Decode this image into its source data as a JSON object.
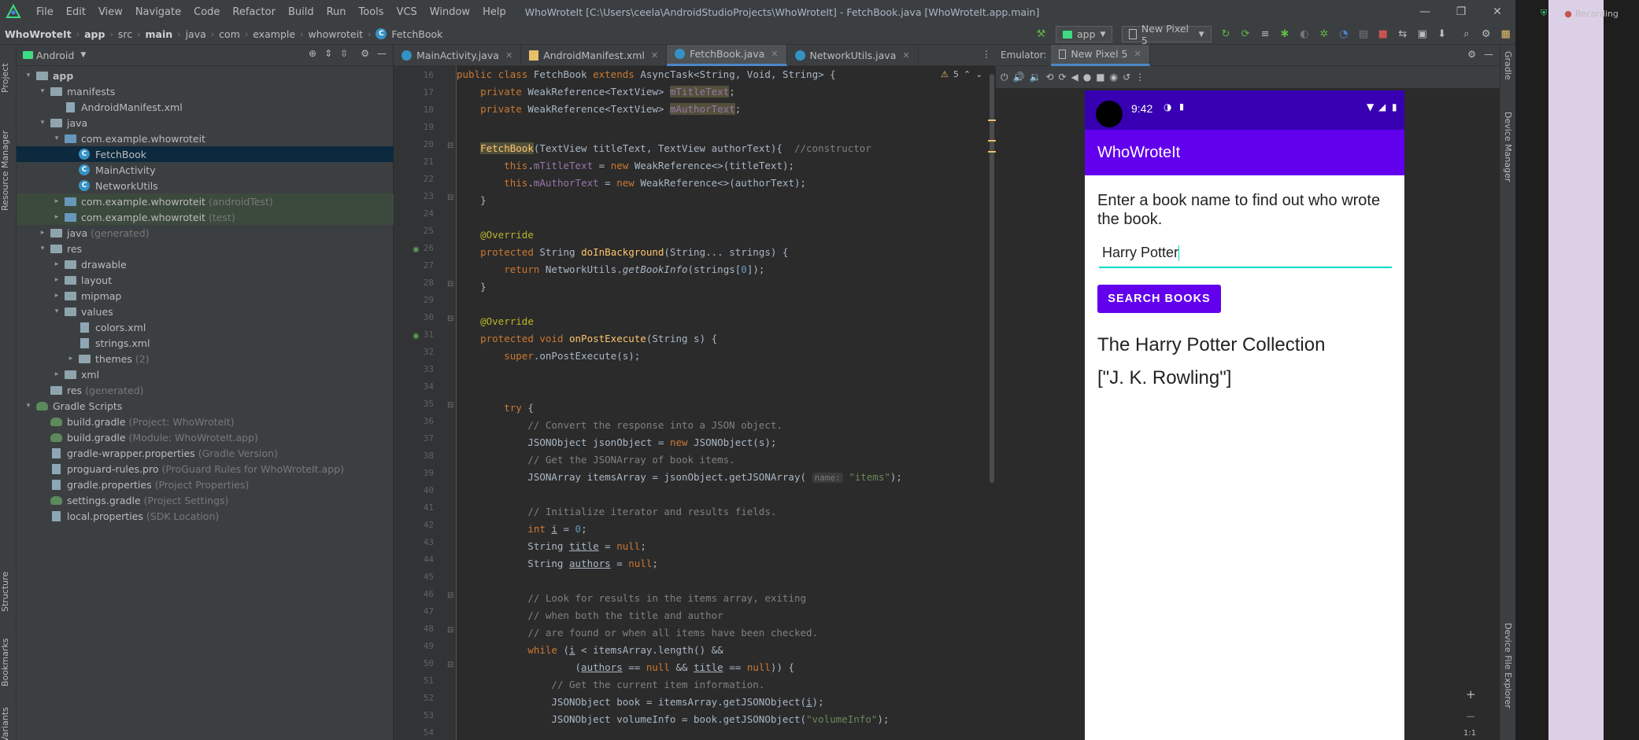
{
  "app": {
    "menu": [
      "File",
      "Edit",
      "View",
      "Navigate",
      "Code",
      "Refactor",
      "Build",
      "Run",
      "Tools",
      "VCS",
      "Window",
      "Help"
    ],
    "window_title": "WhoWroteIt [C:\\Users\\ceela\\AndroidStudioProjects\\WhoWroteIt] - FetchBook.java [WhoWroteIt.app.main]"
  },
  "breadcrumb": [
    "WhoWroteIt",
    "app",
    "src",
    "main",
    "java",
    "com",
    "example",
    "whowroteit",
    "FetchBook"
  ],
  "toolbar": {
    "run_config": "app",
    "device": "New Pixel 5"
  },
  "left_strip": {
    "project": "Project",
    "resource_manager": "Resource Manager",
    "structure": "Structure",
    "bookmarks": "Bookmarks",
    "variants": "Variants"
  },
  "project_panel": {
    "view": "Android",
    "tree": [
      {
        "label": "app",
        "hint": "",
        "level": 0,
        "open": true,
        "icon": "folder-icon"
      },
      {
        "label": "manifests",
        "hint": "",
        "level": 1,
        "open": true,
        "icon": "folder-icon"
      },
      {
        "label": "AndroidManifest.xml",
        "hint": "",
        "level": 2,
        "icon": "xml-file-icon"
      },
      {
        "label": "java",
        "hint": "",
        "level": 1,
        "open": true,
        "icon": "folder-icon"
      },
      {
        "label": "com.example.whowroteit",
        "hint": "",
        "level": 2,
        "open": true,
        "icon": "package-icon"
      },
      {
        "label": "FetchBook",
        "hint": "",
        "level": 3,
        "icon": "class-icon",
        "selected": true
      },
      {
        "label": "MainActivity",
        "hint": "",
        "level": 3,
        "icon": "class-icon"
      },
      {
        "label": "NetworkUtils",
        "hint": "",
        "level": 3,
        "icon": "class-icon"
      },
      {
        "label": "com.example.whowroteit",
        "hint": "(androidTest)",
        "level": 2,
        "open": false,
        "icon": "package-icon",
        "green": true
      },
      {
        "label": "com.example.whowroteit",
        "hint": "(test)",
        "level": 2,
        "open": false,
        "icon": "package-icon",
        "green": true
      },
      {
        "label": "java",
        "hint": "(generated)",
        "level": 1,
        "open": false,
        "icon": "folder-icon"
      },
      {
        "label": "res",
        "hint": "",
        "level": 1,
        "open": true,
        "icon": "folder-icon"
      },
      {
        "label": "drawable",
        "hint": "",
        "level": 2,
        "open": false,
        "icon": "folder-icon"
      },
      {
        "label": "layout",
        "hint": "",
        "level": 2,
        "open": false,
        "icon": "folder-icon"
      },
      {
        "label": "mipmap",
        "hint": "",
        "level": 2,
        "open": false,
        "icon": "folder-icon"
      },
      {
        "label": "values",
        "hint": "",
        "level": 2,
        "open": true,
        "icon": "folder-icon"
      },
      {
        "label": "colors.xml",
        "hint": "",
        "level": 3,
        "icon": "xml-file-icon"
      },
      {
        "label": "strings.xml",
        "hint": "",
        "level": 3,
        "icon": "xml-file-icon"
      },
      {
        "label": "themes",
        "hint": "(2)",
        "level": 3,
        "open": false,
        "icon": "folder-icon"
      },
      {
        "label": "xml",
        "hint": "",
        "level": 2,
        "open": false,
        "icon": "folder-icon"
      },
      {
        "label": "res",
        "hint": "(generated)",
        "level": 1,
        "icon": "folder-icon"
      },
      {
        "label": "Gradle Scripts",
        "hint": "",
        "level": 0,
        "open": true,
        "icon": "gradle-icon"
      },
      {
        "label": "build.gradle",
        "hint": "(Project: WhoWroteIt)",
        "level": 1,
        "icon": "gradle-icon"
      },
      {
        "label": "build.gradle",
        "hint": "(Module: WhoWroteIt.app)",
        "level": 1,
        "icon": "gradle-icon"
      },
      {
        "label": "gradle-wrapper.properties",
        "hint": "(Gradle Version)",
        "level": 1,
        "icon": "properties-file-icon"
      },
      {
        "label": "proguard-rules.pro",
        "hint": "(ProGuard Rules for WhoWroteIt.app)",
        "level": 1,
        "icon": "properties-file-icon"
      },
      {
        "label": "gradle.properties",
        "hint": "(Project Properties)",
        "level": 1,
        "icon": "properties-file-icon"
      },
      {
        "label": "settings.gradle",
        "hint": "(Project Settings)",
        "level": 1,
        "icon": "gradle-icon"
      },
      {
        "label": "local.properties",
        "hint": "(SDK Location)",
        "level": 1,
        "icon": "properties-file-icon"
      }
    ]
  },
  "editor": {
    "tabs": [
      {
        "label": "MainActivity.java",
        "icon": "java-class-icon",
        "active": false
      },
      {
        "label": "AndroidManifest.xml",
        "icon": "xml-file-icon",
        "active": false
      },
      {
        "label": "FetchBook.java",
        "icon": "java-class-icon",
        "active": true
      },
      {
        "label": "NetworkUtils.java",
        "icon": "java-class-icon",
        "active": false
      }
    ],
    "warnings": "5",
    "line_numbers": [
      "16",
      "17",
      "18",
      "19",
      "20",
      "21",
      "22",
      "23",
      "24",
      "25",
      "26",
      "27",
      "28",
      "29",
      "30",
      "31",
      "32",
      "33",
      "34",
      "35",
      "36",
      "37",
      "38",
      "39",
      "40",
      "41",
      "42",
      "43",
      "44",
      "45",
      "46",
      "47",
      "48",
      "49",
      "50",
      "51",
      "52",
      "53",
      "54"
    ],
    "param_hint": "name:"
  },
  "emulator": {
    "label": "Emulator:",
    "tab": "New Pixel 5",
    "time": "9:42",
    "app_title": "WhoWroteIt",
    "prompt": "Enter a book name to find out who wrote the book.",
    "input_value": "Harry Potter",
    "button": "SEARCH BOOKS",
    "result_title": "The Harry Potter Collection",
    "result_author": "[\"J. K. Rowling\"]",
    "zoom_plus": "+",
    "zoom_minus": "−",
    "zoom_ratio": "1:1"
  },
  "right_strip": {
    "gradle": "Gradle",
    "device_manager": "Device Manager",
    "device_file_explorer": "Device File Explorer"
  },
  "desktop": {
    "recording": "Recording"
  },
  "colors": {
    "purple_700": "#3700b3",
    "purple_500": "#6200ee",
    "teal": "#03dac5"
  }
}
